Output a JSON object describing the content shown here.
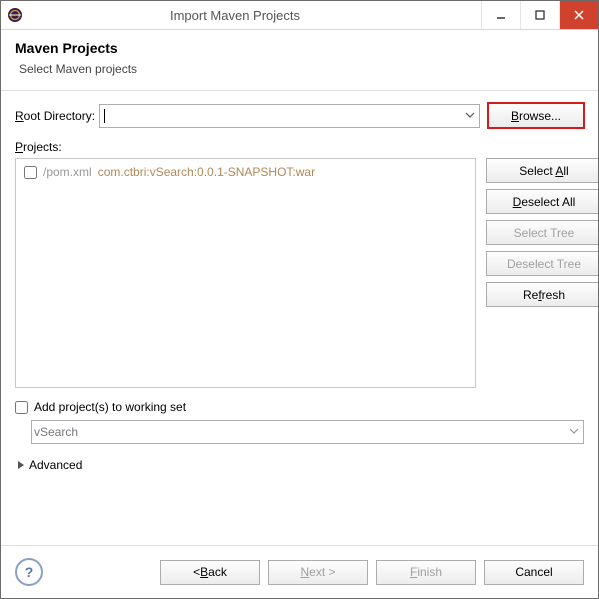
{
  "title": "Import Maven Projects",
  "header": {
    "h1": "Maven Projects",
    "h2": "Select Maven projects"
  },
  "rootDir": {
    "label": "Root Directory:",
    "value": "",
    "browse": "Browse..."
  },
  "projectsLabel": "Projects:",
  "item": {
    "path": "/pom.xml",
    "coords": "com.ctbri:vSearch:0.0.1-SNAPSHOT:war",
    "checked": false
  },
  "side": {
    "selectAll": "Select All",
    "deselectAll": "Deselect All",
    "selectTree": "Select Tree",
    "deselectTree": "Deselect Tree",
    "refresh": "Refresh"
  },
  "ws": {
    "chkLabel": "Add project(s) to working set",
    "checked": false,
    "value": "vSearch"
  },
  "advanced": "Advanced",
  "footer": {
    "back": "< Back",
    "next": "Next >",
    "finish": "Finish",
    "cancel": "Cancel"
  }
}
